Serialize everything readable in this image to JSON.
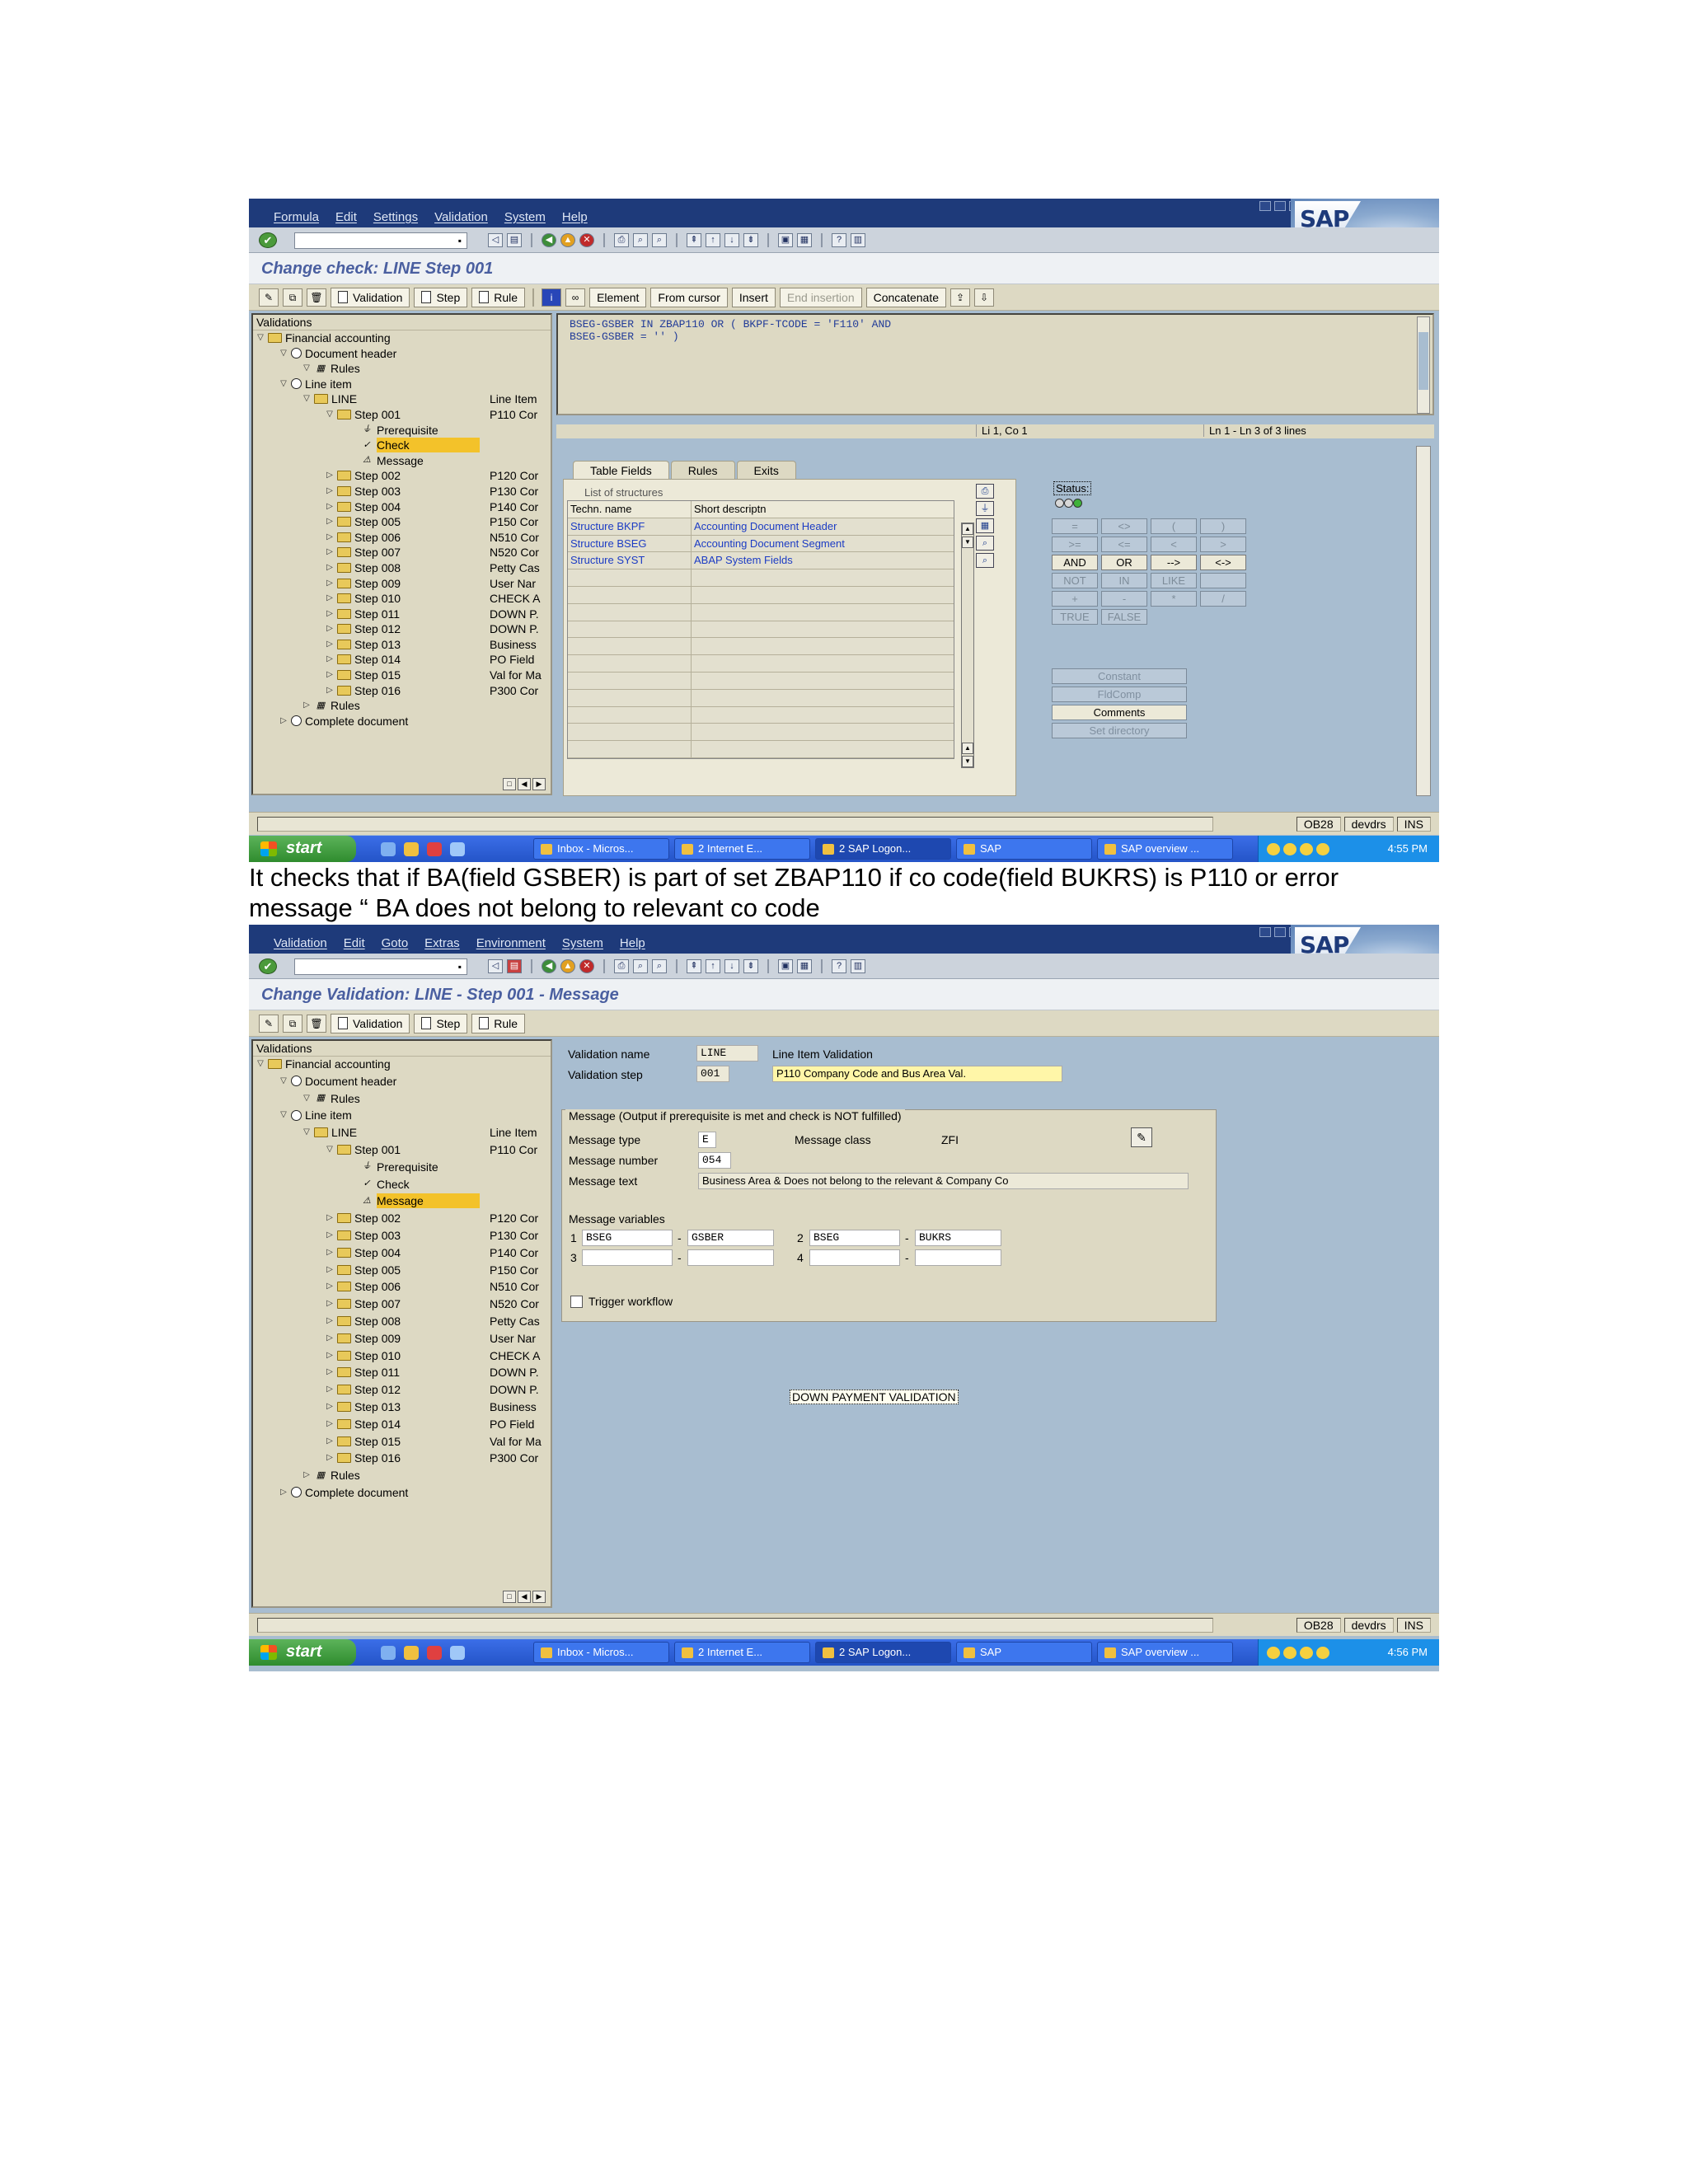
{
  "shot1": {
    "menu": [
      "Formula",
      "Edit",
      "Settings",
      "Validation",
      "System",
      "Help"
    ],
    "title": "Change check: LINE Step 001",
    "app_toolbar": [
      "Validation",
      "Step",
      "Rule",
      "Element",
      "From cursor",
      "Insert",
      "End insertion",
      "Concatenate"
    ],
    "tree": {
      "header": "Validations",
      "nodes": [
        {
          "label": "Financial accounting",
          "desc": ""
        },
        {
          "label": "Document header",
          "desc": ""
        },
        {
          "label": "Rules",
          "desc": ""
        },
        {
          "label": "Line item",
          "desc": ""
        },
        {
          "label": "LINE",
          "desc": "Line Item"
        },
        {
          "label": "Step 001",
          "desc": "P110 Cor"
        },
        {
          "label": "Prerequisite",
          "desc": ""
        },
        {
          "label": "Check",
          "desc": ""
        },
        {
          "label": "Message",
          "desc": ""
        },
        {
          "label": "Step 002",
          "desc": "P120 Cor"
        },
        {
          "label": "Step 003",
          "desc": "P130 Cor"
        },
        {
          "label": "Step 004",
          "desc": "P140 Cor"
        },
        {
          "label": "Step 005",
          "desc": "P150 Cor"
        },
        {
          "label": "Step 006",
          "desc": "N510 Cor"
        },
        {
          "label": "Step 007",
          "desc": "N520 Cor"
        },
        {
          "label": "Step 008",
          "desc": "Petty Cas"
        },
        {
          "label": "Step 009",
          "desc": "User Nar"
        },
        {
          "label": "Step 010",
          "desc": "CHECK A"
        },
        {
          "label": "Step 011",
          "desc": "DOWN P."
        },
        {
          "label": "Step 012",
          "desc": "DOWN P."
        },
        {
          "label": "Step 013",
          "desc": "Business"
        },
        {
          "label": "Step 014",
          "desc": "PO Field"
        },
        {
          "label": "Step 015",
          "desc": "Val for Ma"
        },
        {
          "label": "Step 016",
          "desc": "P300 Cor"
        },
        {
          "label": "Rules",
          "desc": ""
        },
        {
          "label": "Complete document",
          "desc": ""
        }
      ]
    },
    "editor_lines": [
      "BSEG-GSBER IN ZBAP110 OR ( BKPF-TCODE = 'F110' AND",
      "BSEG-GSBER = '' )"
    ],
    "editor_status": {
      "pos": "Li 1, Co 1",
      "lines": "Ln 1 - Ln 3 of 3 lines"
    },
    "tabs": [
      "Table Fields",
      "Rules",
      "Exits"
    ],
    "structures": {
      "title": "List of structures",
      "headers": [
        "Techn. name",
        "Short descriptn"
      ],
      "rows": [
        [
          "Structure BKPF",
          "Accounting Document Header"
        ],
        [
          "Structure BSEG",
          "Accounting Document Segment"
        ],
        [
          "Structure SYST",
          "ABAP System Fields"
        ]
      ]
    },
    "status_label": "Status:",
    "operators": [
      "=",
      "<>",
      "(",
      ")",
      ">=",
      "<=",
      "<",
      ">",
      "AND",
      "OR",
      "-->",
      "<->",
      "NOT",
      "IN",
      "LIKE",
      "",
      "+",
      "-",
      "*",
      "/",
      "TRUE",
      "FALSE"
    ],
    "op_buttons": [
      "Constant",
      "FldComp",
      "Comments",
      "Set directory"
    ],
    "statusbar": {
      "tcode": "OB28",
      "system": "devdrs",
      "mode": "INS"
    },
    "taskbar": {
      "start": "start",
      "tasks": [
        "Inbox - Micros...",
        "2 Internet E...",
        "2 SAP Logon...",
        "SAP",
        "SAP overview ..."
      ],
      "time": "4:55 PM"
    }
  },
  "caption": "It checks that if BA(field GSBER) is part of set ZBAP110 if co code(field BUKRS) is P110 or error message “ BA does not belong to relevant co code",
  "shot2": {
    "menu": [
      "Validation",
      "Edit",
      "Goto",
      "Extras",
      "Environment",
      "System",
      "Help"
    ],
    "title": "Change Validation: LINE - Step 001 - Message",
    "app_toolbar": [
      "Validation",
      "Step",
      "Rule"
    ],
    "tree_selected": "Message",
    "tooltip": "DOWN PAYMENT VALIDATION",
    "form": {
      "validation_name_label": "Validation name",
      "validation_name": "LINE",
      "validation_name_desc": "Line Item Validation",
      "validation_step_label": "Validation step",
      "validation_step": "001",
      "validation_step_desc": "P110 Company Code and Bus Area Val.",
      "group_title": "Message (Output if prerequisite is met and check is NOT fulfilled)",
      "message_type_label": "Message type",
      "message_type": "E",
      "message_class_label": "Message class",
      "message_class": "ZFI",
      "message_number_label": "Message number",
      "message_number": "054",
      "message_text_label": "Message text",
      "message_text": "Business Area & Does not belong to the relevant & Company Co",
      "message_variables_label": "Message variables",
      "vars": [
        {
          "n": "1",
          "table": "BSEG",
          "field": "GSBER"
        },
        {
          "n": "2",
          "table": "BSEG",
          "field": "BUKRS"
        },
        {
          "n": "3",
          "table": "",
          "field": ""
        },
        {
          "n": "4",
          "table": "",
          "field": ""
        }
      ],
      "trigger_workflow_label": "Trigger workflow"
    },
    "statusbar": {
      "tcode": "OB28",
      "system": "devdrs",
      "mode": "INS"
    },
    "taskbar": {
      "start": "start",
      "tasks": [
        "Inbox - Micros...",
        "2 Internet E...",
        "2 SAP Logon...",
        "SAP",
        "SAP overview ..."
      ],
      "time": "4:56 PM"
    }
  },
  "colors": {
    "menubar": "#1e3a7a",
    "workarea": "#a8bdd0",
    "tree_selection": "#f3c22a",
    "link_blue": "#1c3cc4",
    "title_text": "#4a5fa0"
  }
}
